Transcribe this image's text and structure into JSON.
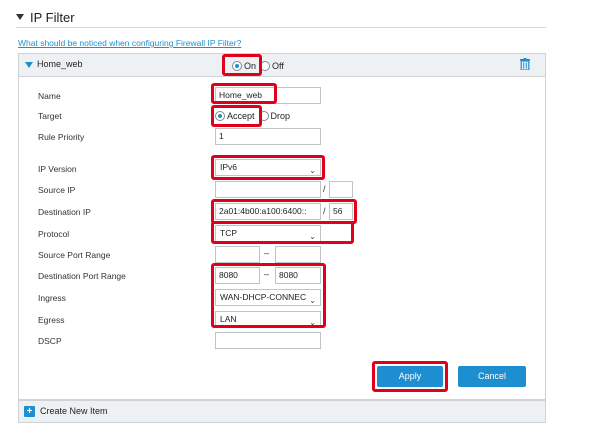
{
  "section": {
    "title": "IP Filter",
    "help_link": "What should be noticed when configuring Firewall IP Filter?"
  },
  "item": {
    "name": "Home_web",
    "toggle": {
      "on_label": "On",
      "off_label": "Off",
      "selected": "On"
    }
  },
  "fields": {
    "name": {
      "label": "Name",
      "value": "Home_web"
    },
    "target": {
      "label": "Target",
      "options": [
        "Accept",
        "Drop"
      ],
      "selected": "Accept"
    },
    "rule_priority": {
      "label": "Rule Priority",
      "value": "1"
    },
    "ip_version": {
      "label": "IP Version",
      "value": "IPv6"
    },
    "source_ip": {
      "label": "Source IP",
      "address": "",
      "separator": "/",
      "prefix": ""
    },
    "destination_ip": {
      "label": "Destination IP",
      "address": "2a01:4b00:a100:6400::",
      "separator": "/",
      "prefix": "56"
    },
    "protocol": {
      "label": "Protocol",
      "value": "TCP"
    },
    "source_port_range": {
      "label": "Source Port Range",
      "from": "",
      "separator": "–",
      "to": ""
    },
    "destination_port_range": {
      "label": "Destination Port Range",
      "from": "8080",
      "separator": "–",
      "to": "8080"
    },
    "ingress": {
      "label": "Ingress",
      "value": "WAN-DHCP-CONNEC"
    },
    "egress": {
      "label": "Egress",
      "value": "LAN"
    },
    "dscp": {
      "label": "DSCP",
      "value": ""
    }
  },
  "buttons": {
    "apply": "Apply",
    "cancel": "Cancel"
  },
  "footer": {
    "create_label": "Create New Item"
  },
  "colors": {
    "accent": "#1d8fd1",
    "highlight": "#e0001b",
    "header_bg": "#eef1f3"
  },
  "icons": {
    "section_toggle": "triangle-down-icon",
    "delete": "trash-icon",
    "add": "plus-icon",
    "dropdown": "chevron-down-icon"
  }
}
